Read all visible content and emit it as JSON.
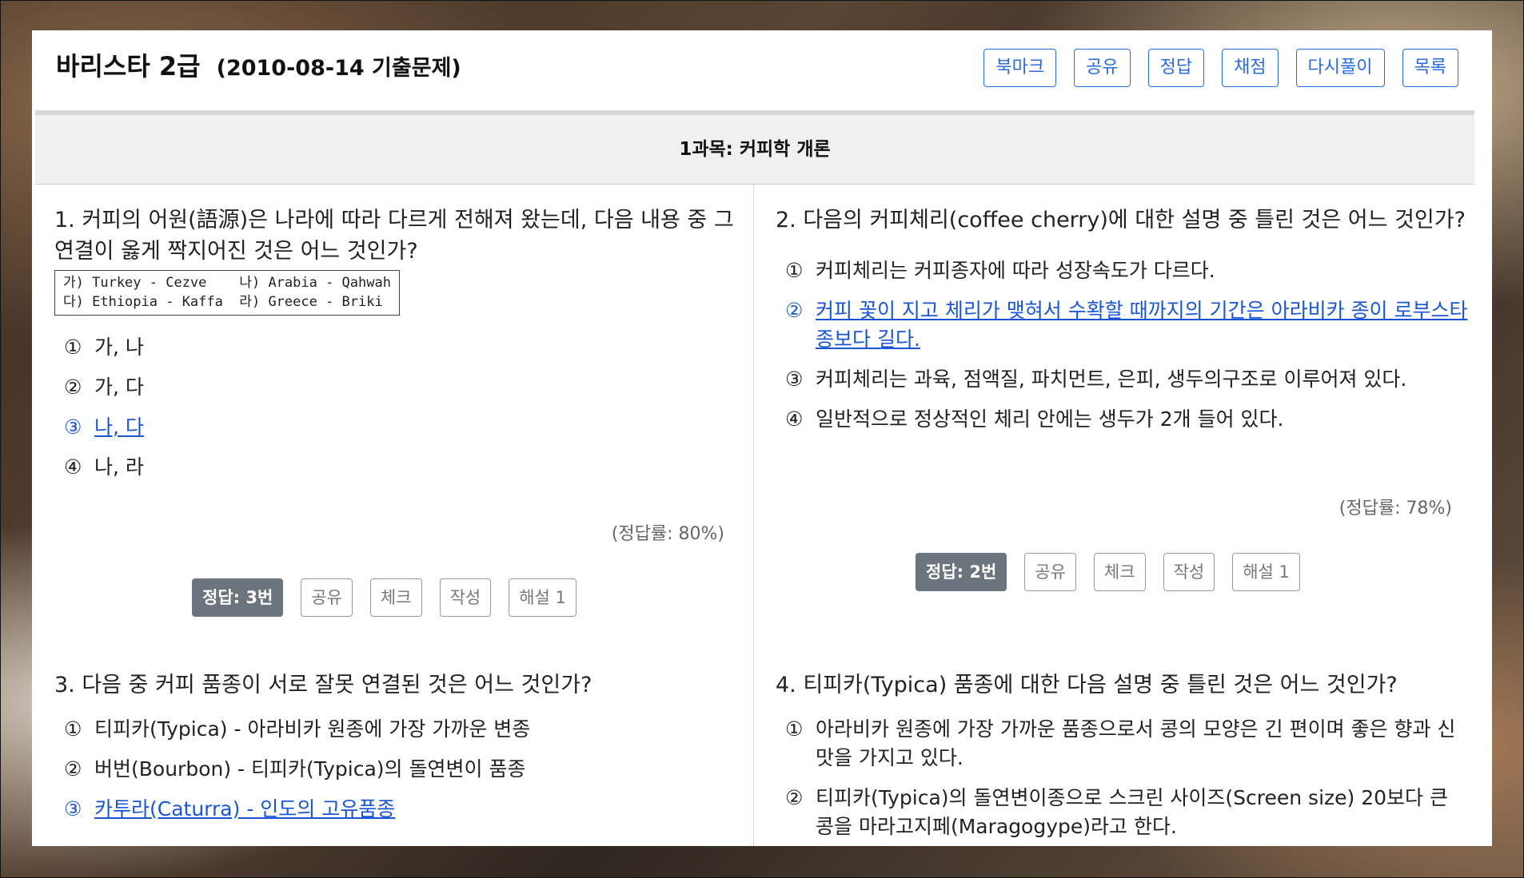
{
  "header": {
    "title": "바리스타 2급",
    "date": "(2010-08-14 기출문제)",
    "buttons": [
      "북마크",
      "공유",
      "정답",
      "채점",
      "다시풀이",
      "목록"
    ]
  },
  "subject": "1과목: 커피학 개론",
  "questions": [
    {
      "text": "1. 커피의 어원(語源)은 나라에 따라 다르게 전해져 왔는데, 다음 내용 중 그 연결이 옳게 짝지어진 것은 어느 것인가?",
      "box_line1": "가) Turkey - Cezve    나) Arabia - Qahwah",
      "box_line2": "다) Ethiopia - Kaffa  라) Greece - Briki",
      "options": [
        {
          "num": "①",
          "text": "가, 나"
        },
        {
          "num": "②",
          "text": "가, 다"
        },
        {
          "num": "③",
          "text": "나, 다"
        },
        {
          "num": "④",
          "text": "나, 라"
        }
      ],
      "rate": "(정답률: 80%)",
      "actions": [
        "정답: 3번",
        "공유",
        "체크",
        "작성",
        "해설 1"
      ]
    },
    {
      "text": "2. 다음의 커피체리(coffee cherry)에 대한 설명 중 틀린 것은 어느 것인가?",
      "options": [
        {
          "num": "①",
          "text": "커피체리는 커피종자에 따라 성장속도가 다르다."
        },
        {
          "num": "②",
          "text": "커피 꽃이 지고 체리가 맺혀서 수확할 때까지의 기간은 아라비카 종이 로부스타 종보다 길다."
        },
        {
          "num": "③",
          "text": "커피체리는 과육, 점액질, 파치먼트, 은피, 생두의구조로 이루어져 있다."
        },
        {
          "num": "④",
          "text": "일반적으로 정상적인 체리 안에는 생두가 2개 들어 있다."
        }
      ],
      "rate": "(정답률: 78%)",
      "actions": [
        "정답: 2번",
        "공유",
        "체크",
        "작성",
        "해설 1"
      ]
    },
    {
      "text": "3. 다음 중 커피 품종이 서로 잘못 연결된 것은 어느 것인가?",
      "options": [
        {
          "num": "①",
          "text": "티피카(Typica) - 아라비카 원종에 가장 가까운 변종"
        },
        {
          "num": "②",
          "text": "버번(Bourbon) - 티피카(Typica)의 돌연변이 품종"
        },
        {
          "num": "③",
          "text": "카투라(Caturra) - 인도의 고유품종"
        }
      ]
    },
    {
      "text": "4. 티피카(Typica) 품종에 대한 다음 설명 중 틀린 것은 어느 것인가?",
      "options": [
        {
          "num": "①",
          "text": "아라비카 원종에 가장 가까운 품종으로서 콩의 모양은 긴 편이며 좋은 향과 신맛을 가지고 있다."
        },
        {
          "num": "②",
          "text": "티피카(Typica)의 돌연변이종으로 스크린 사이즈(Screen size) 20보다 큰 콩을 마라고지페(Maragogype)라고 한다."
        }
      ]
    }
  ],
  "colors": {
    "link": "#1a55d6",
    "answer_bg": "#6c757d",
    "header_btn": "#2b6be0"
  }
}
